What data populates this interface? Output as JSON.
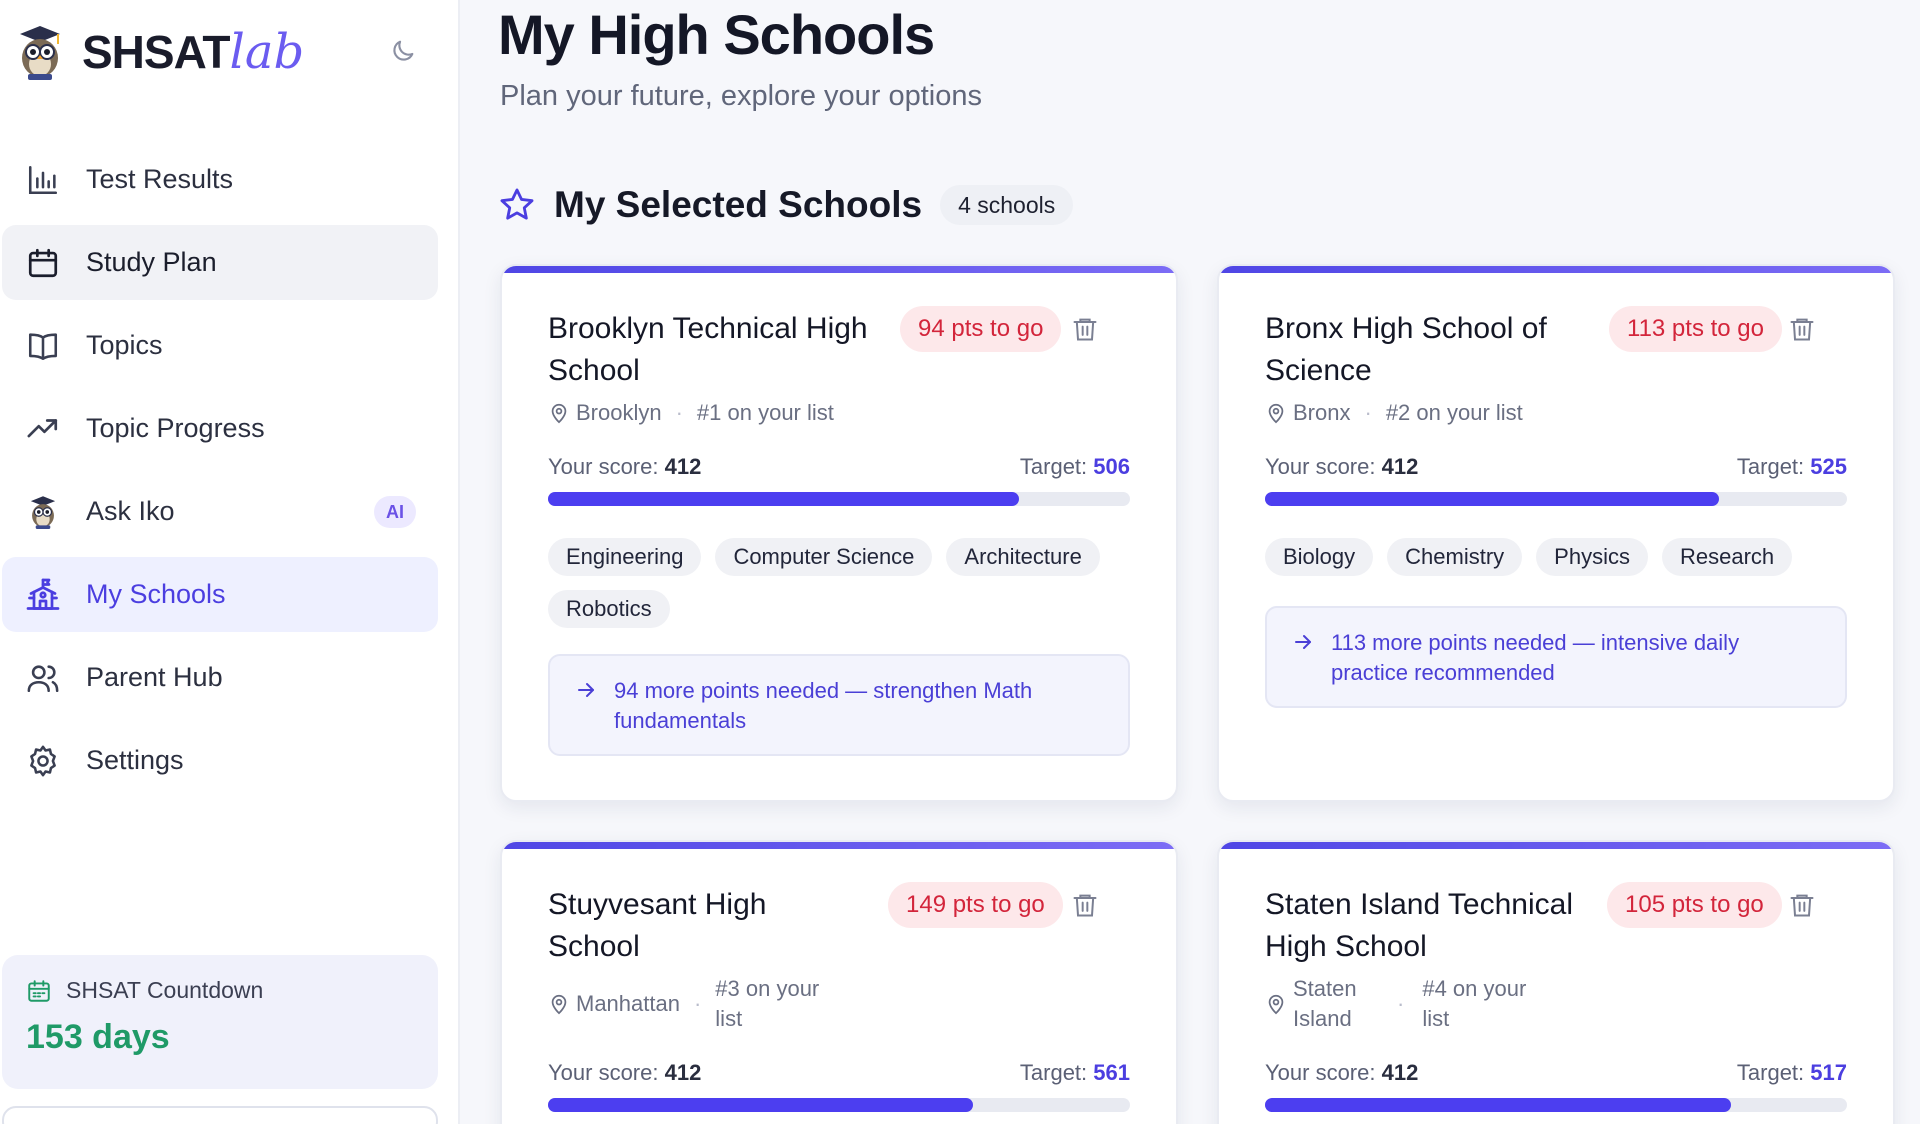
{
  "brand": {
    "name_main": "SHSAT",
    "name_accent": "lab"
  },
  "sidebar": {
    "items": [
      {
        "label": "Test Results",
        "icon": "bar-chart-icon"
      },
      {
        "label": "Study Plan",
        "icon": "calendar-icon"
      },
      {
        "label": "Topics",
        "icon": "book-icon"
      },
      {
        "label": "Topic Progress",
        "icon": "trending-up-icon"
      },
      {
        "label": "Ask Iko",
        "icon": "owl-icon",
        "badge": "AI"
      },
      {
        "label": "My Schools",
        "icon": "school-icon"
      },
      {
        "label": "Parent Hub",
        "icon": "users-icon"
      },
      {
        "label": "Settings",
        "icon": "gear-icon"
      }
    ],
    "countdown": {
      "label": "SHSAT Countdown",
      "value": "153 days"
    }
  },
  "header": {
    "title": "My High Schools",
    "subtitle": "Plan your future, explore your options"
  },
  "section": {
    "title": "My Selected Schools",
    "count": "4 schools"
  },
  "score_label": "Your score:",
  "target_label": "Target:",
  "schools": [
    {
      "name": "Brooklyn Technical High School",
      "pts": "94 pts to go",
      "borough": "Brooklyn",
      "rank": "#1 on your list",
      "score": "412",
      "target": "506",
      "progress": 0.81,
      "tags": [
        "Engineering",
        "Computer Science",
        "Architecture",
        "Robotics"
      ],
      "advice": "94 more points needed — strengthen Math fundamentals"
    },
    {
      "name": "Bronx High School of Science",
      "pts": "113 pts to go",
      "borough": "Bronx",
      "rank": "#2 on your list",
      "score": "412",
      "target": "525",
      "progress": 0.78,
      "tags": [
        "Biology",
        "Chemistry",
        "Physics",
        "Research"
      ],
      "advice": "113 more points needed — intensive daily practice recommended"
    },
    {
      "name": "Stuyvesant High School",
      "pts": "149 pts to go",
      "borough": "Manhattan",
      "rank": "#3 on your list",
      "score": "412",
      "target": "561",
      "progress": 0.73
    },
    {
      "name": "Staten Island Technical High School",
      "pts": "105 pts to go",
      "borough": "Staten Island",
      "rank": "#4 on your list",
      "score": "412",
      "target": "517",
      "progress": 0.8
    }
  ],
  "colors": {
    "accent": "#4c3ef0",
    "danger": "#d3253b",
    "success": "#1f9a67"
  }
}
